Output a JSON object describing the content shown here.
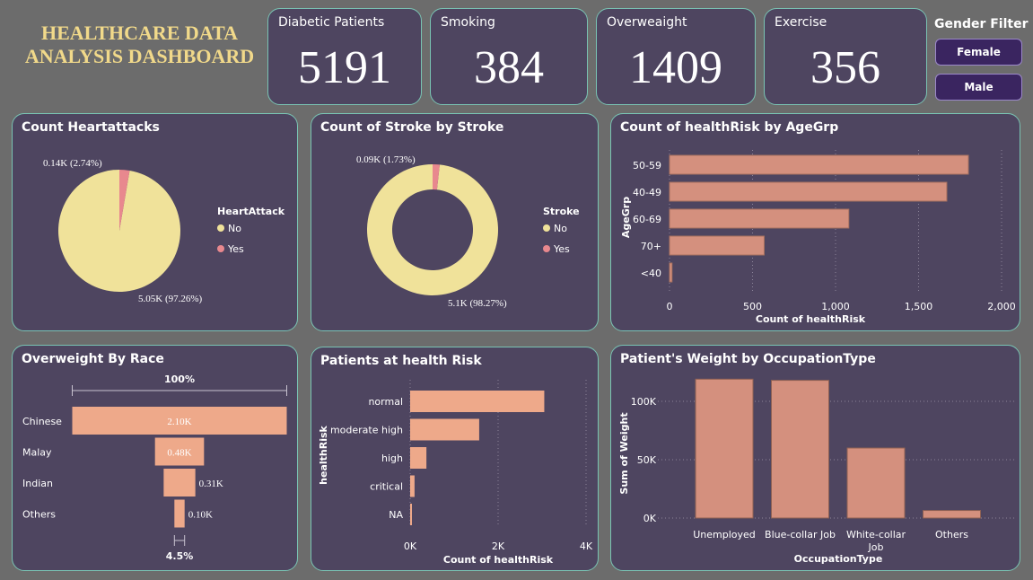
{
  "dashboard": {
    "title": "HEALTHCARE DATA ANALYSIS DASHBOARD"
  },
  "kpis": [
    {
      "label": "Diabetic Patients",
      "value": "5191"
    },
    {
      "label": "Smoking",
      "value": "384"
    },
    {
      "label": "Overweaight",
      "value": "1409"
    },
    {
      "label": "Exercise",
      "value": "356"
    }
  ],
  "filter": {
    "title": "Gender Filter",
    "options": [
      "Female",
      "Male"
    ]
  },
  "colors": {
    "pie_main": "#f0e29a",
    "pie_minor": "#e8888e",
    "bar": "#d4907e",
    "funnel": "#eea98a"
  },
  "chart_data": [
    {
      "type": "pie",
      "title": "Count Heartattacks",
      "legend_title": "HeartAttack",
      "legend_position": "right",
      "slices": [
        {
          "name": "No",
          "value": 5050,
          "label": "5.05K (97.26%)"
        },
        {
          "name": "Yes",
          "value": 140,
          "label": "0.14K (2.74%)"
        }
      ]
    },
    {
      "type": "pie",
      "donut": true,
      "title": "Count of Stroke by Stroke",
      "legend_title": "Stroke",
      "legend_position": "right",
      "slices": [
        {
          "name": "No",
          "value": 5100,
          "label": "5.1K (98.27%)"
        },
        {
          "name": "Yes",
          "value": 90,
          "label": "0.09K (1.73%)"
        }
      ]
    },
    {
      "type": "bar",
      "orientation": "horizontal",
      "title": "Count of healthRisk by AgeGrp",
      "categories": [
        "50-59",
        "40-49",
        "60-69",
        "70+",
        "<40"
      ],
      "values": [
        1800,
        1670,
        1080,
        570,
        15
      ],
      "xlabel": "Count of healthRisk",
      "ylabel": "AgeGrp",
      "xlim": [
        0,
        2000
      ],
      "xticks": [
        "0",
        "500",
        "1,000",
        "1,500",
        "2,000"
      ]
    },
    {
      "type": "funnel",
      "title": "Overweight By Race",
      "top_label": "100%",
      "bottom_label": "4.5%",
      "categories": [
        "Chinese",
        "Malay",
        "Indian",
        "Others"
      ],
      "values": [
        2100,
        480,
        310,
        100
      ],
      "data_labels": [
        "2.10K",
        "0.48K",
        "0.31K",
        "0.10K"
      ]
    },
    {
      "type": "bar",
      "orientation": "horizontal",
      "title": "Patients at health Risk",
      "categories": [
        "normal",
        "moderate high",
        "high",
        "critical",
        "NA"
      ],
      "values": [
        3050,
        1570,
        370,
        100,
        10
      ],
      "xlabel": "Count of healthRisk",
      "ylabel": "healthRisk",
      "xlim": [
        0,
        4000
      ],
      "xticks": [
        "0K",
        "2K",
        "4K"
      ]
    },
    {
      "type": "bar",
      "title": "Patient's Weight by OccupationType",
      "categories": [
        "Unemployed",
        "Blue-collar Job",
        "White-collar Job",
        "Others"
      ],
      "values": [
        119000,
        118000,
        60000,
        6500
      ],
      "xlabel": "OccupationType",
      "ylabel": "Sum of Weight",
      "ylim": [
        0,
        120000
      ],
      "yticks": [
        "0K",
        "50K",
        "100K"
      ]
    }
  ]
}
